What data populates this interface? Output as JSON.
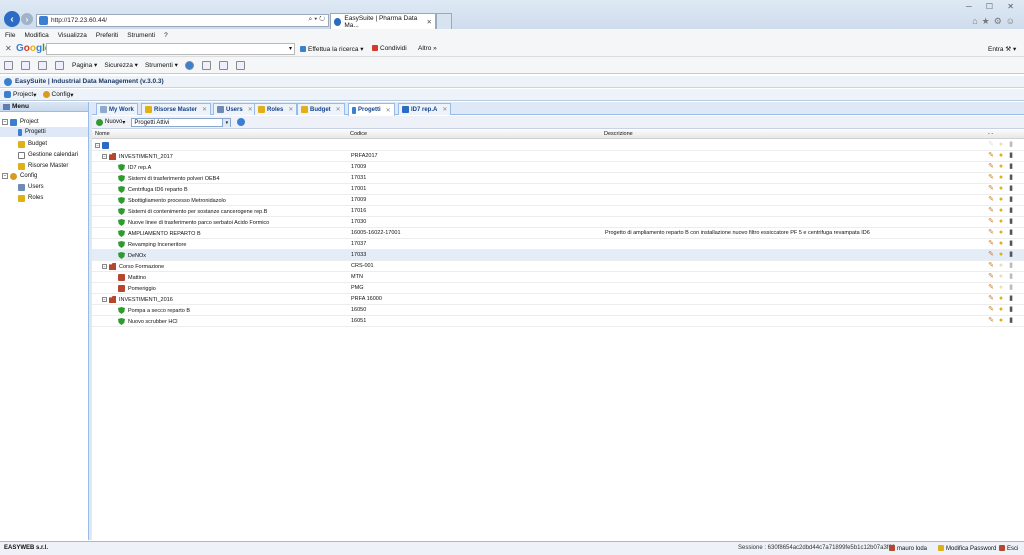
{
  "browser": {
    "url": "http://172.23.60.44/",
    "tab_title": "EasySuite | Pharma Data Ma...",
    "menu": [
      "File",
      "Modifica",
      "Visualizza",
      "Preferiti",
      "Strumenti",
      "?"
    ],
    "search_engine": "Google",
    "search_button": "Effettua la ricerca",
    "share_button": "Condividi",
    "more_button": "Altro",
    "signin": "Entra",
    "command_items": [
      "Pagina",
      "Sicurezza",
      "Strumenti"
    ]
  },
  "app": {
    "title": "EasySuite | Industrial Data Management (v.3.0.3)",
    "menus": [
      "Project",
      "Config"
    ]
  },
  "sidebar": {
    "title": "Menu",
    "nodes": [
      {
        "label": "Project"
      },
      {
        "label": "Progetti"
      },
      {
        "label": "Budget"
      },
      {
        "label": "Gestione calendari"
      },
      {
        "label": "Risorse Master"
      },
      {
        "label": "Config"
      },
      {
        "label": "Users"
      },
      {
        "label": "Roles"
      }
    ]
  },
  "tabs": [
    "My Work",
    "Risorse Master",
    "Users",
    "Roles",
    "Budget",
    "Progetti",
    "ID7 rep.A"
  ],
  "toolbar": {
    "new_label": "Nuovo",
    "filter_value": "Progetti Attivi"
  },
  "grid": {
    "columns": [
      "Nome",
      "Codice",
      "Descrizione"
    ],
    "header_actions": "- -",
    "rows": [
      {
        "name": "INVESTIMENTI_2017",
        "code": "PRFA2017",
        "desc": ""
      },
      {
        "name": "ID7 rep.A",
        "code": "17009",
        "desc": ""
      },
      {
        "name": "Sistemi di trasferimento polveri OEB4",
        "code": "17031",
        "desc": ""
      },
      {
        "name": "Centrifuga ID6 reparto B",
        "code": "17001",
        "desc": ""
      },
      {
        "name": "Sbottigliamento processo Metronidazolo",
        "code": "17009",
        "desc": ""
      },
      {
        "name": "Sistemi di contenimento per sostanze cancerogene rep.B",
        "code": "17016",
        "desc": ""
      },
      {
        "name": "Nuove linee di trasferimento parco serbatoi Acido Formico",
        "code": "17030",
        "desc": ""
      },
      {
        "name": "AMPLIAMENTO REPARTO B",
        "code": "16005-16022-17001",
        "desc": "Progetto di ampliamento reparto B con installazione nuovo filtro essiccatore PF 5 e centrifuga revampata ID6"
      },
      {
        "name": "Revamping Inceneritore",
        "code": "17037",
        "desc": ""
      },
      {
        "name": "DeNOx",
        "code": "17033",
        "desc": ""
      },
      {
        "name": "Corso Formazione",
        "code": "CRS-001",
        "desc": ""
      },
      {
        "name": "Mattino",
        "code": "MTN",
        "desc": ""
      },
      {
        "name": "Pomeriggio",
        "code": "PMG",
        "desc": ""
      },
      {
        "name": "INVESTIMENTI_2016",
        "code": "PRFA 16000",
        "desc": ""
      },
      {
        "name": "Pompa a secco reparto B",
        "code": "16050",
        "desc": ""
      },
      {
        "name": "Nuovo scrubber HCl",
        "code": "16051",
        "desc": ""
      }
    ]
  },
  "status": {
    "company": "EASYWEB s.r.l.",
    "session": "Sessione : 630f8654ac2dbd44c7a71899fe5b1c12b07a3f68",
    "user": "mauro loda",
    "change_password": "Modifica Password",
    "exit": "Esci"
  }
}
